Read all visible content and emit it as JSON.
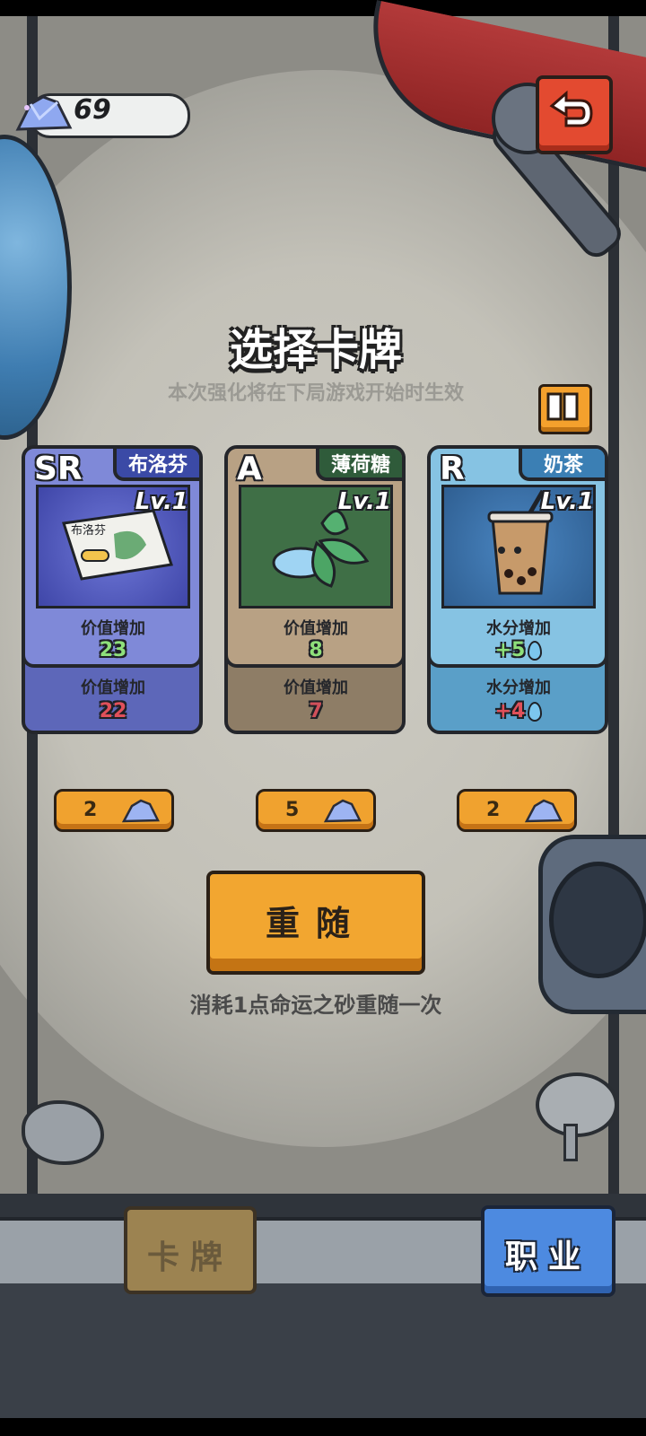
{
  "currency": {
    "value": "69",
    "icon": "sand-gem-icon"
  },
  "header": {
    "title": "选择卡牌",
    "subtitle": "本次强化将在下局游戏开始时生效"
  },
  "cards": [
    {
      "rarity": "SR",
      "name": "布洛芬",
      "level": "Lv.1",
      "art_text": "布洛芬",
      "front_label": "价值增加",
      "front_value": "23",
      "back_label": "价值增加",
      "back_value": "22",
      "theme": "#6b73c9",
      "name_color": "#3b4aa6",
      "front_value_color": "#8ee07a",
      "back_value_color": "#e0505a",
      "cost": "2"
    },
    {
      "rarity": "A",
      "name": "薄荷糖",
      "level": "Lv.1",
      "front_label": "价值增加",
      "front_value": "8",
      "back_label": "价值增加",
      "back_value": "7",
      "theme": "#b49a7a",
      "name_color": "#2f5b3a",
      "front_value_color": "#8ee07a",
      "back_value_color": "#d0505a",
      "cost": "5"
    },
    {
      "rarity": "R",
      "name": "奶茶",
      "level": "Lv.1",
      "front_label": "水分增加",
      "front_value": "+5",
      "back_label": "水分增加",
      "back_value": "+4",
      "theme": "#74b6d9",
      "name_color": "#3b7fb4",
      "front_value_color": "#8ee07a",
      "back_value_color": "#e0505a",
      "cost": "2"
    }
  ],
  "reroll": {
    "label": "重随",
    "hint": "消耗1点命运之砂重随一次"
  },
  "tabs": {
    "cards": "卡牌",
    "job": "职业"
  }
}
